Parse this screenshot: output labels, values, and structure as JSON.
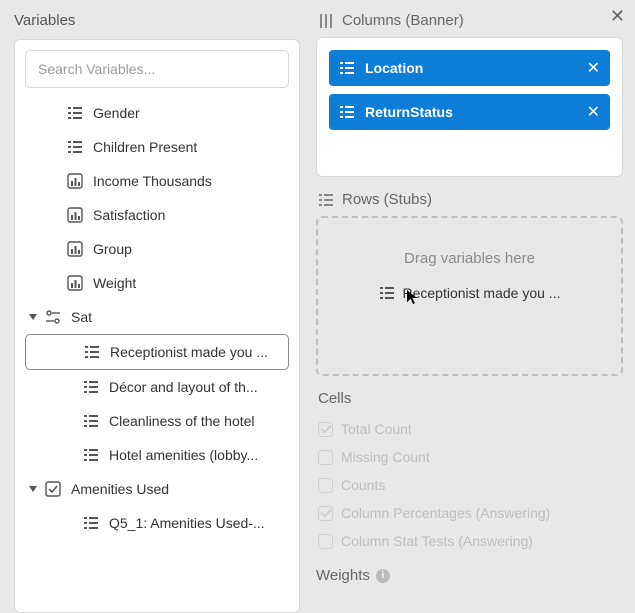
{
  "left": {
    "title": "Variables",
    "search_placeholder": "Search Variables...",
    "items": [
      {
        "label": "Gender",
        "icon": "list",
        "level": 1
      },
      {
        "label": "Children Present",
        "icon": "list",
        "level": 1
      },
      {
        "label": "Income Thousands",
        "icon": "bar",
        "level": 1
      },
      {
        "label": "Satisfaction",
        "icon": "bar",
        "level": 1
      },
      {
        "label": "Group",
        "icon": "bar",
        "level": 1
      },
      {
        "label": "Weight",
        "icon": "bar",
        "level": 1
      },
      {
        "label": "Sat",
        "icon": "sliders",
        "level": 0,
        "expandable": true
      },
      {
        "label": "Receptionist made you ...",
        "icon": "list",
        "level": 2,
        "selected": true
      },
      {
        "label": "Décor and layout of th...",
        "icon": "list",
        "level": 2
      },
      {
        "label": "Cleanliness of the hotel",
        "icon": "list",
        "level": 2
      },
      {
        "label": "Hotel amenities (lobby...",
        "icon": "list",
        "level": 2
      },
      {
        "label": "Amenities Used",
        "icon": "check",
        "level": 0,
        "expandable": true
      },
      {
        "label": "Q5_1: Amenities Used-...",
        "icon": "list",
        "level": 2
      }
    ]
  },
  "columns": {
    "title": "Columns (Banner)",
    "pills": [
      {
        "label": "Location"
      },
      {
        "label": "ReturnStatus"
      }
    ]
  },
  "rows": {
    "title": "Rows (Stubs)",
    "placeholder": "Drag variables here",
    "ghost_label": "Receptionist made you ..."
  },
  "cells": {
    "title": "Cells",
    "options": [
      {
        "label": "Total Count",
        "checked": true
      },
      {
        "label": "Missing Count",
        "checked": false
      },
      {
        "label": "Counts",
        "checked": false
      },
      {
        "label": "Column Percentages (Answering)",
        "checked": true
      },
      {
        "label": "Column Stat Tests (Answering)",
        "checked": false
      }
    ]
  },
  "weights": {
    "title": "Weights"
  }
}
